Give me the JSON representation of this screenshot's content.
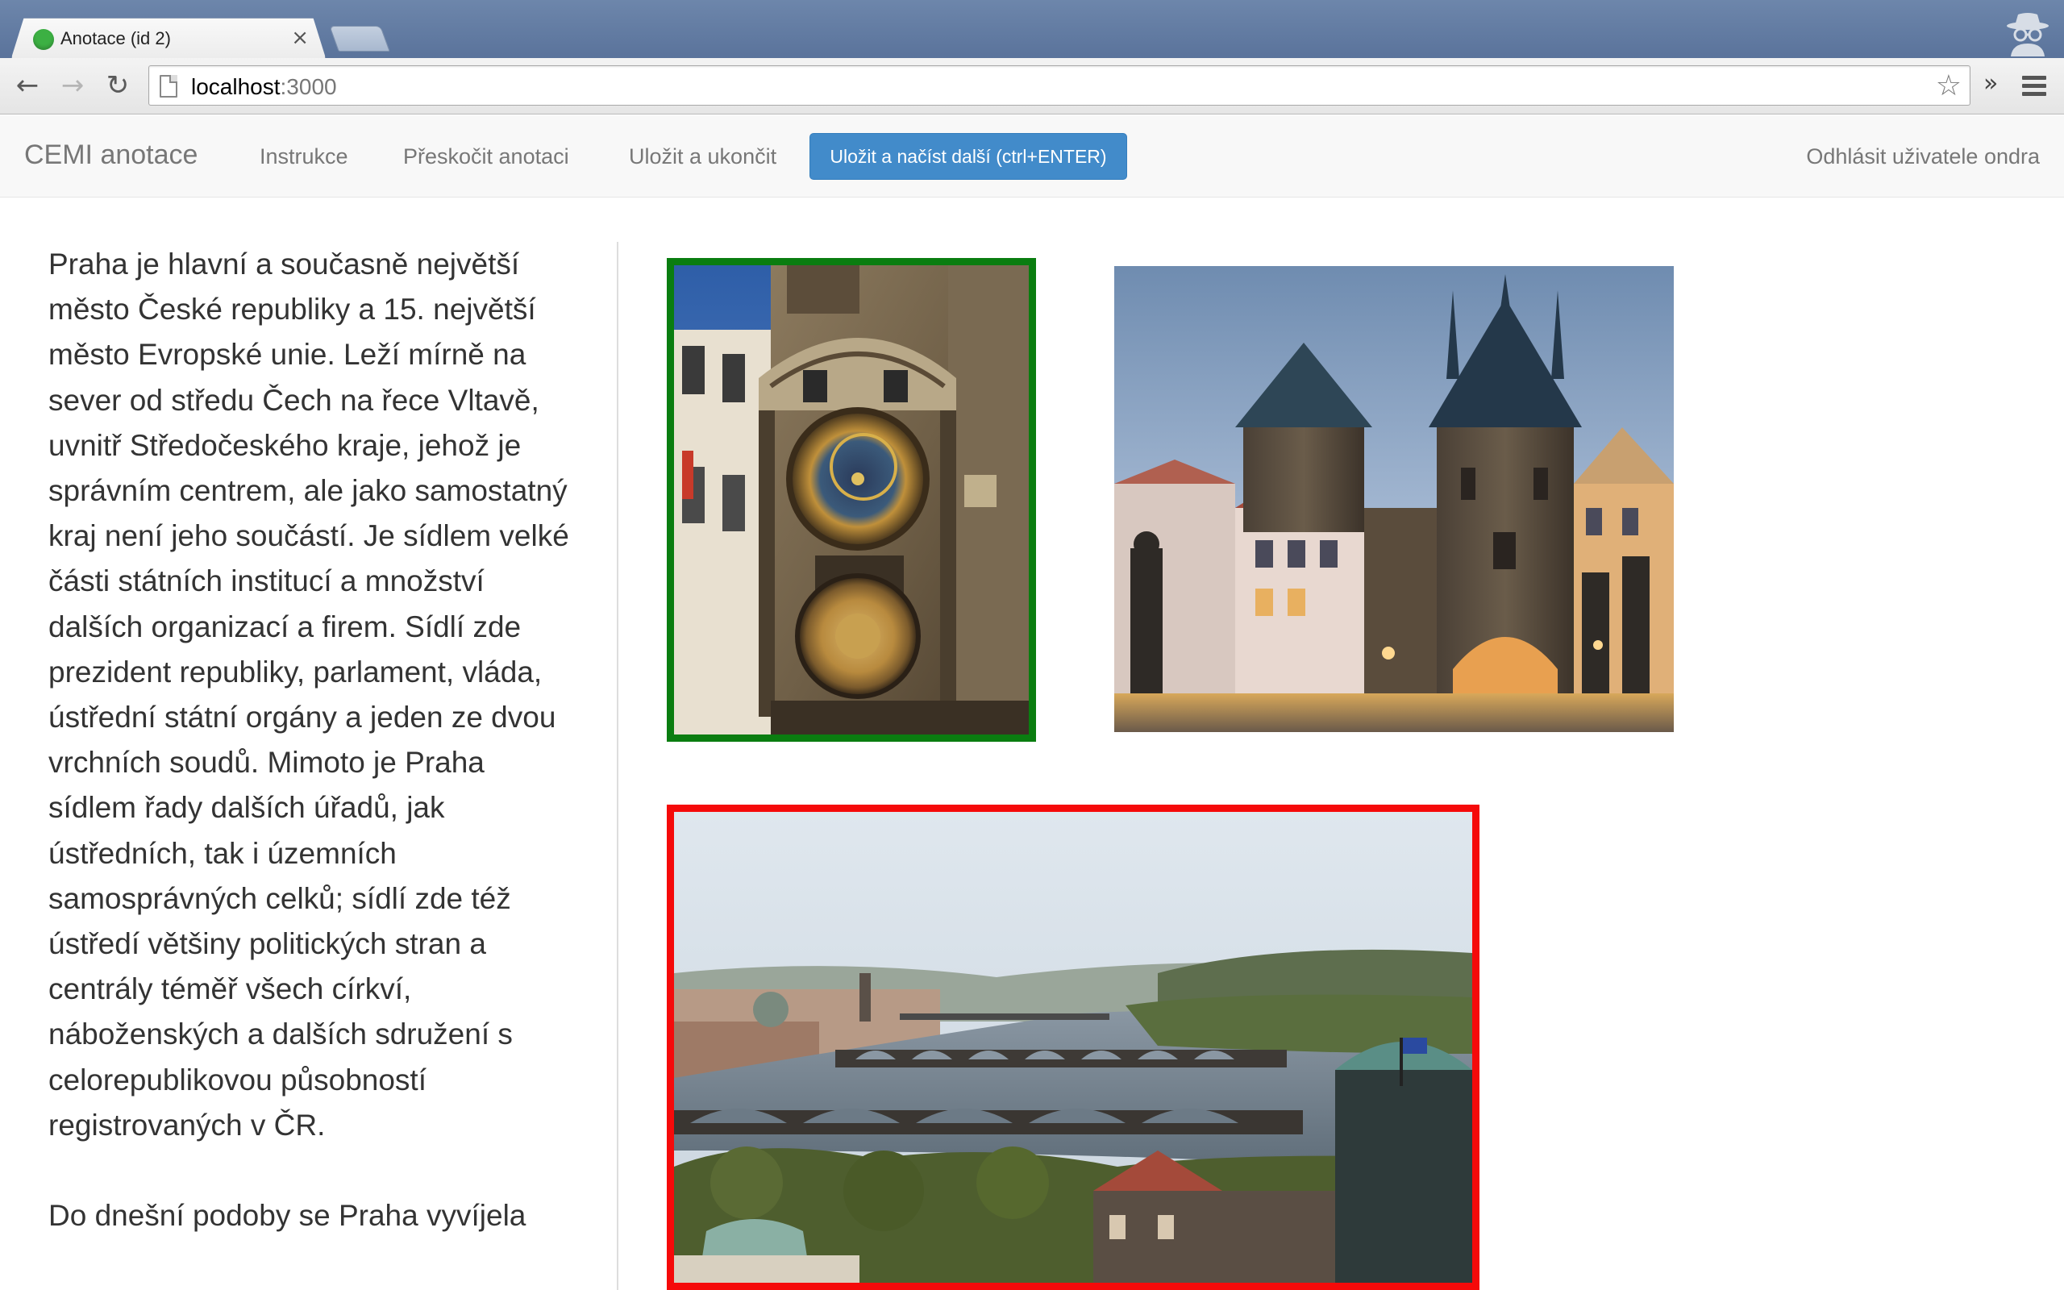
{
  "browser": {
    "tab_title": "Anotace (id 2)",
    "tab_close": "×",
    "url_host": "localhost",
    "url_port": ":3000",
    "back_icon": "←",
    "forward_icon": "→",
    "reload_icon": "↻",
    "star_icon": "☆",
    "extensions_chevron": "»"
  },
  "navbar": {
    "brand": "CEMI anotace",
    "links": [
      "Instrukce",
      "Přeskočit anotaci",
      "Uložit a ukončit"
    ],
    "primary_button": "Uložit a načíst další (ctrl+ENTER)",
    "logout": "Odhlásit uživatele ondra"
  },
  "article": {
    "paragraphs": [
      "Praha je hlavní a současně největší město České republiky a 15. největší město Evropské unie. Leží mírně na sever od středu Čech na řece Vltavě, uvnitř Středočeského kraje, jehož je správním centrem, ale jako samostatný kraj není jeho součástí. Je sídlem velké části státních institucí a množství dalších organizací a firem. Sídlí zde prezident republiky, parlament, vláda, ústřední státní orgány a jeden ze dvou vrchních soudů. Mimoto je Praha sídlem řady dalších úřadů, jak ústředních, tak i územních samosprávných celků; sídlí zde též ústředí většiny politických stran a centrály téměř všech církví, náboženských a dalších sdružení s celorepublikovou působností registrovaných v ČR.",
      "Do dnešní podoby se Praha vyvíjela"
    ]
  },
  "images": [
    {
      "subject": "astronomical-clock",
      "selection": "green",
      "border_color": "#0a7d10"
    },
    {
      "subject": "bridge-tower",
      "selection": "none"
    },
    {
      "subject": "vltava-bridges",
      "selection": "red",
      "border_color": "#f50a0a"
    }
  ],
  "colors": {
    "primary": "#428bca",
    "selected_green": "#0a7d10",
    "selected_red": "#f50a0a",
    "text": "#333333",
    "nav_text": "#777777"
  }
}
